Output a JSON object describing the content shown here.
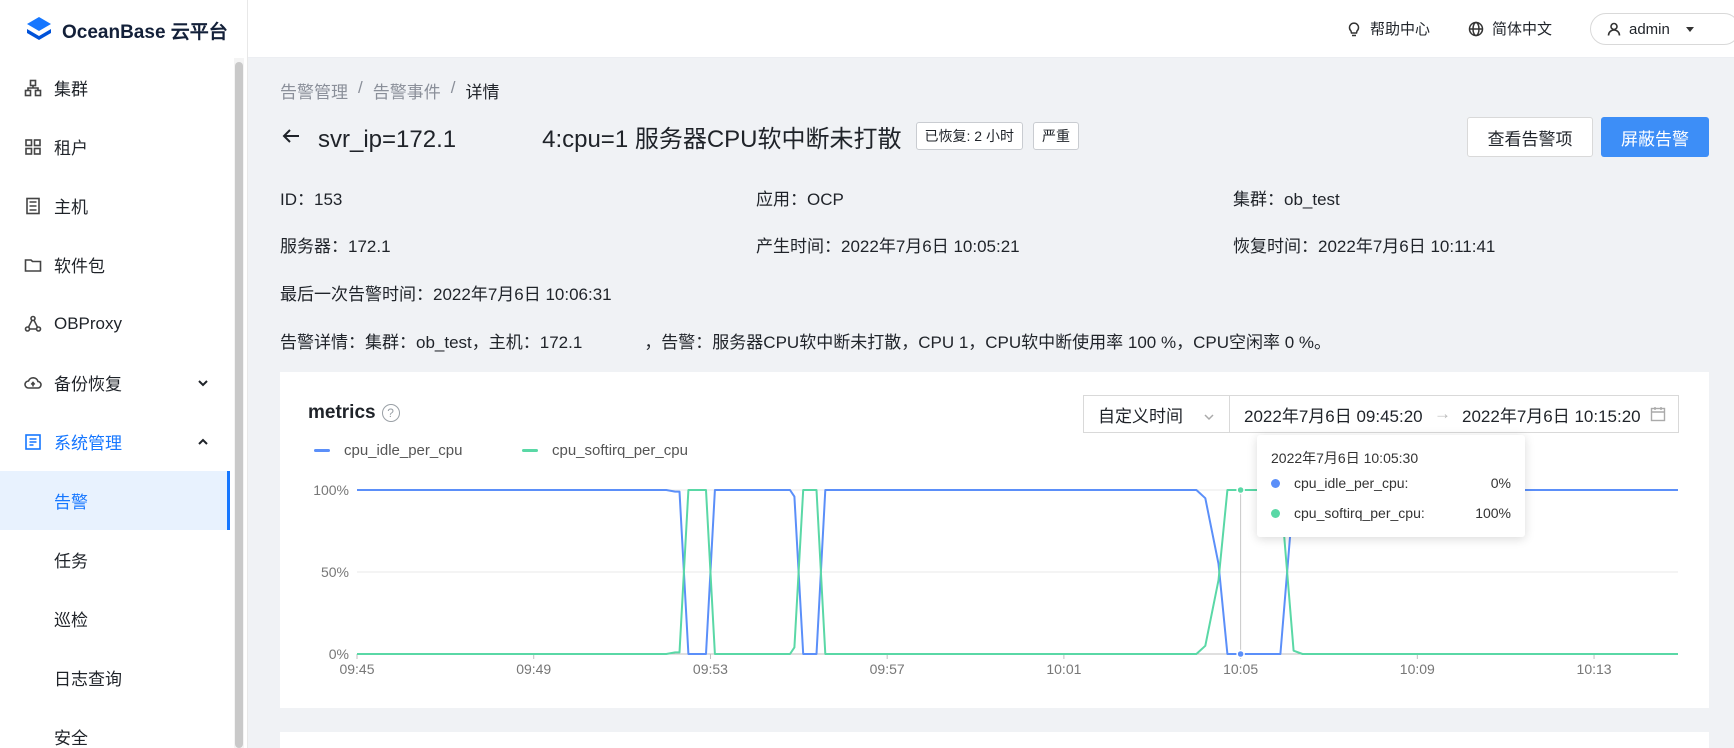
{
  "app": {
    "logo_text": "OceanBase 云平台"
  },
  "header": {
    "help": "帮助中心",
    "language": "简体中文",
    "user": "admin"
  },
  "sidebar": {
    "items": [
      {
        "label": "集群",
        "icon": "cluster-icon"
      },
      {
        "label": "租户",
        "icon": "grid-icon"
      },
      {
        "label": "主机",
        "icon": "server-icon"
      },
      {
        "label": "软件包",
        "icon": "folder-icon"
      },
      {
        "label": "OBProxy",
        "icon": "network-icon"
      },
      {
        "label": "备份恢复",
        "icon": "cloud-backup-icon"
      },
      {
        "label": "系统管理",
        "icon": "system-icon"
      }
    ],
    "sub_items": [
      "告警",
      "任务",
      "巡检",
      "日志查询",
      "安全"
    ]
  },
  "breadcrumb": [
    "告警管理",
    "告警事件",
    "详情"
  ],
  "title": {
    "prefix": "svr_ip=172.1",
    "suffix": "4:cpu=1 服务器CPU软中断未打散",
    "tag_recovered": "已恢复: 2 小时",
    "tag_severity": "严重"
  },
  "actions": {
    "view_items": "查看告警项",
    "mask_alarm": "屏蔽告警"
  },
  "info": {
    "id": "ID：153",
    "app": "应用：OCP",
    "cluster": "集群：ob_test",
    "server": "服务器：172.1",
    "created": "产生时间：2022年7月6日 10:05:21",
    "recovered": "恢复时间：2022年7月6日 10:11:41",
    "last_alarm": "最后一次告警时间：2022年7月6日 10:06:31",
    "detail_prefix": "告警详情：集群：ob_test，主机：172.1",
    "detail_suffix": "，告警：服务器CPU软中断未打散，CPU 1，CPU软中断使用率 100 %，CPU空闲率 0 %。"
  },
  "metrics": {
    "title": "metrics",
    "range_type": "自定义时间",
    "range_start": "2022年7月6日 09:45:20",
    "range_end": "2022年7月6日 10:15:20",
    "arrow": "→"
  },
  "tooltip": {
    "time": "2022年7月6日 10:05:30",
    "rows": [
      {
        "name": "cpu_idle_per_cpu:",
        "value": "0%"
      },
      {
        "name": "cpu_softirq_per_cpu:",
        "value": "100%"
      }
    ]
  },
  "colors": {
    "idle": "#5b8ff9",
    "softirq": "#5ad8a6",
    "accent": "#1677ff",
    "primary_button": "#3d8ef7"
  },
  "chart_data": {
    "type": "line",
    "x_ticks": [
      "09:45",
      "09:49",
      "09:53",
      "09:57",
      "10:01",
      "10:05",
      "10:09",
      "10:13"
    ],
    "y_ticks": [
      "0%",
      "50%",
      "100%"
    ],
    "ylim": [
      0,
      100
    ],
    "xlim_minutes_from_0945": [
      0,
      29.9
    ],
    "legend": "top-left",
    "series": [
      {
        "name": "cpu_idle_per_cpu",
        "points": [
          [
            0,
            100
          ],
          [
            7,
            100
          ],
          [
            7.2,
            99
          ],
          [
            7.3,
            99
          ],
          [
            7.5,
            0
          ],
          [
            7.9,
            0
          ],
          [
            8.1,
            100
          ],
          [
            9.8,
            100
          ],
          [
            9.9,
            96
          ],
          [
            10.1,
            0
          ],
          [
            10.4,
            0
          ],
          [
            10.6,
            100
          ],
          [
            19,
            100
          ],
          [
            19.2,
            95
          ],
          [
            19.5,
            55
          ],
          [
            19.7,
            0
          ],
          [
            20.9,
            0
          ],
          [
            21.2,
            98
          ],
          [
            21.4,
            100
          ],
          [
            29.9,
            100
          ]
        ]
      },
      {
        "name": "cpu_softirq_per_cpu",
        "points": [
          [
            0,
            0
          ],
          [
            7,
            0
          ],
          [
            7.2,
            1
          ],
          [
            7.3,
            1
          ],
          [
            7.5,
            100
          ],
          [
            7.9,
            100
          ],
          [
            8.1,
            0
          ],
          [
            9.8,
            0
          ],
          [
            9.9,
            4
          ],
          [
            10.1,
            100
          ],
          [
            10.4,
            100
          ],
          [
            10.6,
            0
          ],
          [
            19,
            0
          ],
          [
            19.2,
            5
          ],
          [
            19.5,
            45
          ],
          [
            19.7,
            100
          ],
          [
            20.9,
            100
          ],
          [
            21.2,
            2
          ],
          [
            21.4,
            0
          ],
          [
            29.9,
            0
          ]
        ]
      }
    ],
    "hover_x": 20,
    "hover_values": {
      "cpu_idle_per_cpu": 0,
      "cpu_softirq_per_cpu": 100
    }
  }
}
